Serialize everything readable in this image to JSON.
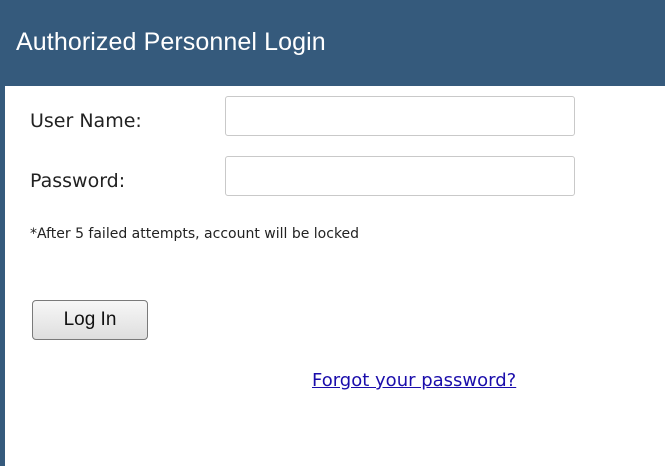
{
  "header": {
    "title": "Authorized Personnel Login"
  },
  "form": {
    "username_label": "User Name:",
    "username_value": "",
    "password_label": "Password:",
    "password_value": "",
    "lockout_note": "*After 5 failed attempts, account will be locked",
    "login_button_label": "Log In",
    "forgot_password_link": "Forgot your password?"
  },
  "colors": {
    "header_background": "#355a7c",
    "header_text": "#ffffff",
    "link": "#1a0dab"
  }
}
